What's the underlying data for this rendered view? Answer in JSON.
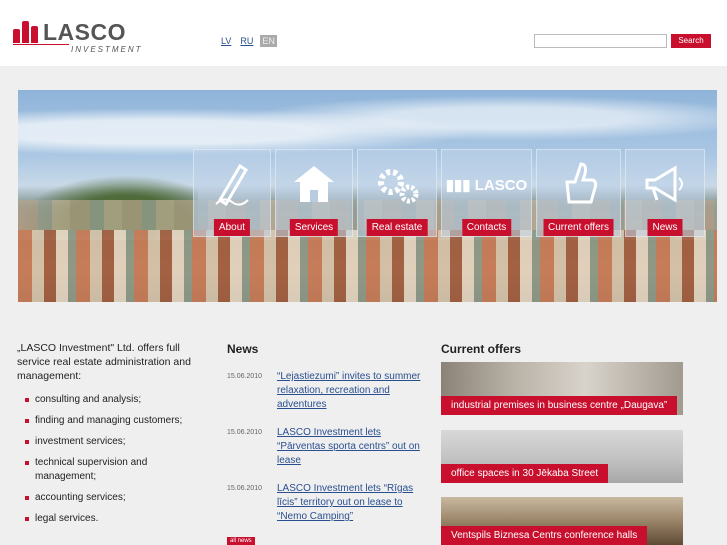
{
  "header": {
    "logo_text": "LASCO",
    "logo_sub": "INVESTMENT",
    "languages": [
      {
        "label": "LV",
        "active": false
      },
      {
        "label": "RU",
        "active": false
      },
      {
        "label": "EN",
        "active": true
      }
    ],
    "search_value": "",
    "search_button": "Search"
  },
  "menu": [
    {
      "label": "About",
      "icon": "pencil-icon"
    },
    {
      "label": "Services",
      "icon": "house-icon"
    },
    {
      "label": "Real estate",
      "icon": "gears-icon"
    },
    {
      "label": "Contacts",
      "icon": "lasco-logo-icon",
      "logo_text": "LASCO"
    },
    {
      "label": "Current offers",
      "icon": "thumbs-up-icon"
    },
    {
      "label": "News",
      "icon": "megaphone-icon"
    }
  ],
  "intro": {
    "text": "„LASCO Investment\" Ltd. offers full service real estate administration and management:",
    "services": [
      "consulting and analysis;",
      "finding and managing customers;",
      "investment services;",
      "technical supervision and management;",
      "accounting services;",
      "legal services."
    ]
  },
  "news": {
    "title": "News",
    "items": [
      {
        "date": "15.06.2010",
        "text": "“Lejastiezumi” invites to summer relaxation, recreation and adventures"
      },
      {
        "date": "15.06.2010",
        "text": "LASCO Investment lets “Pārventas sporta centrs” out on lease"
      },
      {
        "date": "15.06.2010",
        "text": "LASCO Investment lets “Rīgas līcis” territory out on lease to “Nemo Camping”"
      }
    ],
    "all_label": "all news"
  },
  "offers": {
    "title": "Current offers",
    "items": [
      {
        "caption": "industrial premises in business centre „Daugava”"
      },
      {
        "caption": "office spaces in 30 Jēkaba Street"
      },
      {
        "caption": "Ventspils Biznesa Centrs     conference halls"
      }
    ]
  }
}
